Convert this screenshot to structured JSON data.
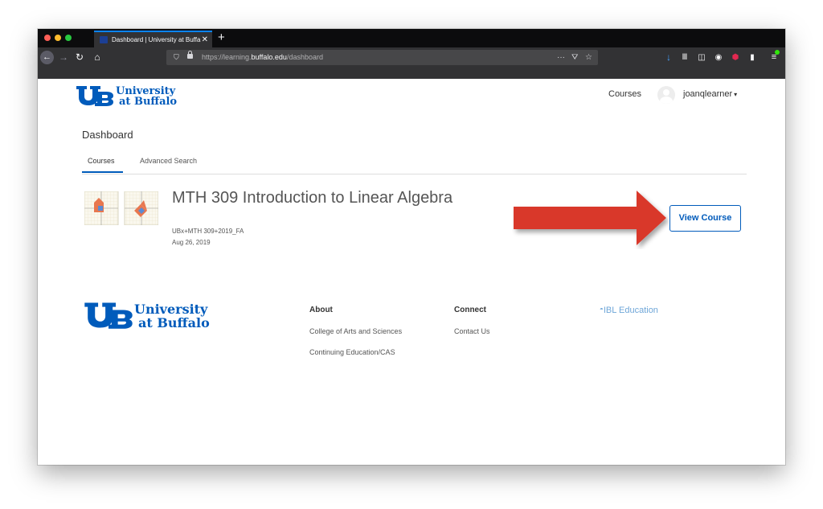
{
  "browser": {
    "tab_title": "Dashboard | University at Buffa",
    "tab_close": "✕",
    "new_tab": "+",
    "url_prefix": "https://learning.",
    "url_domain": "buffalo.edu",
    "url_path": "/dashboard",
    "url_more": "···"
  },
  "header": {
    "logo_line1": "University",
    "logo_line2": "at Buffalo",
    "courses_link": "Courses",
    "username": "joanqlearner",
    "user_caret": "▾"
  },
  "dashboard": {
    "title": "Dashboard",
    "tabs": [
      {
        "label": "Courses"
      },
      {
        "label": "Advanced Search"
      }
    ]
  },
  "course": {
    "title": "MTH 309 Introduction to Linear Algebra",
    "code": "UBx+MTH 309+2019_FA",
    "date": "Aug 26, 2019",
    "button_label": "View Course"
  },
  "footer": {
    "logo_line1": "University",
    "logo_line2": "at Buffalo",
    "about_heading": "About",
    "about_links": [
      "College of Arts and Sciences",
      "Continuing Education/CAS"
    ],
    "connect_heading": "Connect",
    "connect_links": [
      "Contact Us"
    ],
    "ibl_text": "IBL Education"
  },
  "colors": {
    "brand": "#005bbb",
    "annotation_arrow": "#d9382b"
  }
}
